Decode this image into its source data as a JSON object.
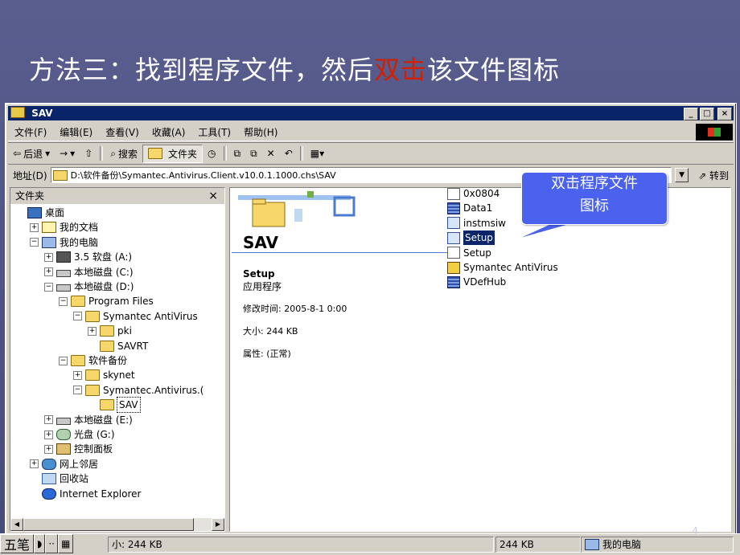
{
  "slide": {
    "title_before": "方法三：找到程序文件，然后",
    "title_highlight": "双击",
    "title_after": "该文件图标",
    "page_number": "4",
    "highlight_color": "#d02000"
  },
  "window": {
    "title": "SAV",
    "controls": {
      "minimize": "_",
      "maximize": "□",
      "close": "×"
    },
    "menu": [
      "文件(F)",
      "编辑(E)",
      "查看(V)",
      "收藏(A)",
      "工具(T)",
      "帮助(H)"
    ],
    "toolbar": {
      "back": "后退",
      "forward": "→",
      "up": "⇧",
      "search": "搜索",
      "folders": "文件夹",
      "history": "◷",
      "move_to": "⧉",
      "copy_to": "⧉",
      "delete": "✕",
      "undo": "↶",
      "views": "▦▾"
    },
    "address": {
      "label": "地址(D)",
      "value": "D:\\软件备份\\Symantec.Antivirus.Client.v10.0.1.1000.chs\\SAV",
      "go": "转到"
    }
  },
  "folders_pane": {
    "header": "文件夹",
    "close": "×",
    "tree": [
      {
        "label": "桌面",
        "icon": "desktop-icon",
        "expander": ""
      },
      {
        "label": "我的文档",
        "icon": "documents-icon",
        "expander": "+"
      },
      {
        "label": "我的电脑",
        "icon": "computer-icon",
        "expander": "−"
      },
      {
        "label": "3.5 软盘 (A:)",
        "icon": "floppy-icon",
        "expander": "+"
      },
      {
        "label": "本地磁盘 (C:)",
        "icon": "drive-icon",
        "expander": "+"
      },
      {
        "label": "本地磁盘 (D:)",
        "icon": "drive-icon",
        "expander": "−"
      },
      {
        "label": "Program Files",
        "icon": "folder-icon",
        "expander": "−"
      },
      {
        "label": "Symantec AntiVirus",
        "icon": "folder-icon",
        "expander": "−"
      },
      {
        "label": "pki",
        "icon": "folder-icon",
        "expander": "+"
      },
      {
        "label": "SAVRT",
        "icon": "folder-icon",
        "expander": ""
      },
      {
        "label": "软件备份",
        "icon": "folder-icon",
        "expander": "−"
      },
      {
        "label": "skynet",
        "icon": "folder-icon",
        "expander": "+"
      },
      {
        "label": "Symantec.Antivirus.(",
        "icon": "folder-icon",
        "expander": "−"
      },
      {
        "label": "SAV",
        "icon": "open-folder-icon",
        "expander": ""
      },
      {
        "label": "本地磁盘 (E:)",
        "icon": "drive-icon",
        "expander": "+"
      },
      {
        "label": "光盘 (G:)",
        "icon": "cd-icon",
        "expander": "+"
      },
      {
        "label": "控制面板",
        "icon": "control-panel-icon",
        "expander": "+"
      },
      {
        "label": "网上邻居",
        "icon": "network-icon",
        "expander": "+"
      },
      {
        "label": "回收站",
        "icon": "recycle-bin-icon",
        "expander": ""
      },
      {
        "label": "Internet Explorer",
        "icon": "ie-icon",
        "expander": ""
      }
    ]
  },
  "details": {
    "folder_name": "SAV",
    "file_name": "Setup",
    "file_type": "应用程序",
    "modified": "修改时间: 2005-8-1 0:00",
    "size": "大小: 244 KB",
    "attributes": "属性: (正常)"
  },
  "files": [
    {
      "name": "0x0804",
      "icon": "ini-icon",
      "selected": false
    },
    {
      "name": "Data1",
      "icon": "cab-icon",
      "selected": false
    },
    {
      "name": "instmsiw",
      "icon": "installer-icon",
      "selected": false
    },
    {
      "name": "Setup",
      "icon": "setup-exe-icon",
      "selected": true
    },
    {
      "name": "Setup",
      "icon": "ini-icon",
      "selected": false
    },
    {
      "name": "Symantec AntiVirus",
      "icon": "msi-icon",
      "selected": false
    },
    {
      "name": "VDefHub",
      "icon": "cab-icon",
      "selected": false
    }
  ],
  "callout": {
    "line1": "双击程序文件",
    "line2": "图标",
    "color": "#4a62ee"
  },
  "statusbar": {
    "ime_mode": "五笔",
    "ime_glyph1": "◗",
    "ime_glyph2": "··",
    "ime_glyph3": "▦",
    "left_text": "小: 244 KB",
    "size": "244 KB",
    "zone": "我的电脑"
  }
}
